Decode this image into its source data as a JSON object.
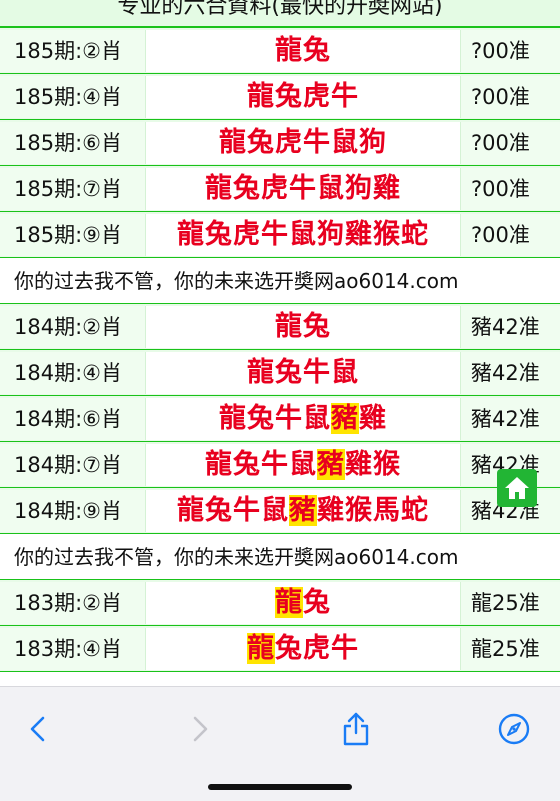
{
  "header": {
    "title": "专业的六合資料(最快的开奬网站)"
  },
  "rows": [
    {
      "type": "pick",
      "period": "185期:②肖",
      "zodiacs": [
        "龍",
        "兔"
      ],
      "hl": [],
      "result": "?00准"
    },
    {
      "type": "pick",
      "period": "185期:④肖",
      "zodiacs": [
        "龍",
        "兔",
        "虎",
        "牛"
      ],
      "hl": [],
      "result": "?00准"
    },
    {
      "type": "pick",
      "period": "185期:⑥肖",
      "zodiacs": [
        "龍",
        "兔",
        "虎",
        "牛",
        "鼠",
        "狗"
      ],
      "hl": [],
      "result": "?00准"
    },
    {
      "type": "pick",
      "period": "185期:⑦肖",
      "zodiacs": [
        "龍",
        "兔",
        "虎",
        "牛",
        "鼠",
        "狗",
        "雞"
      ],
      "hl": [],
      "result": "?00准"
    },
    {
      "type": "pick",
      "period": "185期:⑨肖",
      "zodiacs": [
        "龍",
        "兔",
        "虎",
        "牛",
        "鼠",
        "狗",
        "雞",
        "猴",
        "蛇"
      ],
      "hl": [],
      "result": "?00准"
    },
    {
      "type": "ad",
      "text": "你的过去我不管，你的未来选开奬网ao6014.com"
    },
    {
      "type": "pick",
      "period": "184期:②肖",
      "zodiacs": [
        "龍",
        "兔"
      ],
      "hl": [],
      "result": "豬42准"
    },
    {
      "type": "pick",
      "period": "184期:④肖",
      "zodiacs": [
        "龍",
        "兔",
        "牛",
        "鼠"
      ],
      "hl": [],
      "result": "豬42准"
    },
    {
      "type": "pick",
      "period": "184期:⑥肖",
      "zodiacs": [
        "龍",
        "兔",
        "牛",
        "鼠",
        "豬",
        "雞"
      ],
      "hl": [
        4
      ],
      "result": "豬42准"
    },
    {
      "type": "pick",
      "period": "184期:⑦肖",
      "zodiacs": [
        "龍",
        "兔",
        "牛",
        "鼠",
        "豬",
        "雞",
        "猴"
      ],
      "hl": [
        4
      ],
      "result": "豬42准"
    },
    {
      "type": "pick",
      "period": "184期:⑨肖",
      "zodiacs": [
        "龍",
        "兔",
        "牛",
        "鼠",
        "豬",
        "雞",
        "猴",
        "馬",
        "蛇"
      ],
      "hl": [
        4
      ],
      "result": "豬42准"
    },
    {
      "type": "ad",
      "text": "你的过去我不管，你的未来选开奬网ao6014.com"
    },
    {
      "type": "pick",
      "period": "183期:②肖",
      "zodiacs": [
        "龍",
        "兔"
      ],
      "hl": [
        0
      ],
      "result": "龍25准"
    },
    {
      "type": "pick",
      "period": "183期:④肖",
      "zodiacs": [
        "龍",
        "兔",
        "虎",
        "牛"
      ],
      "hl": [
        0
      ],
      "result": "龍25准"
    }
  ],
  "colors": {
    "accent_green": "#19c219",
    "pick_red": "#e8001f",
    "highlight": "#ffe400"
  },
  "icons": {
    "home": "home-icon",
    "back": "chevron-left-icon",
    "forward": "chevron-right-icon",
    "share": "share-icon",
    "compass": "compass-icon"
  }
}
